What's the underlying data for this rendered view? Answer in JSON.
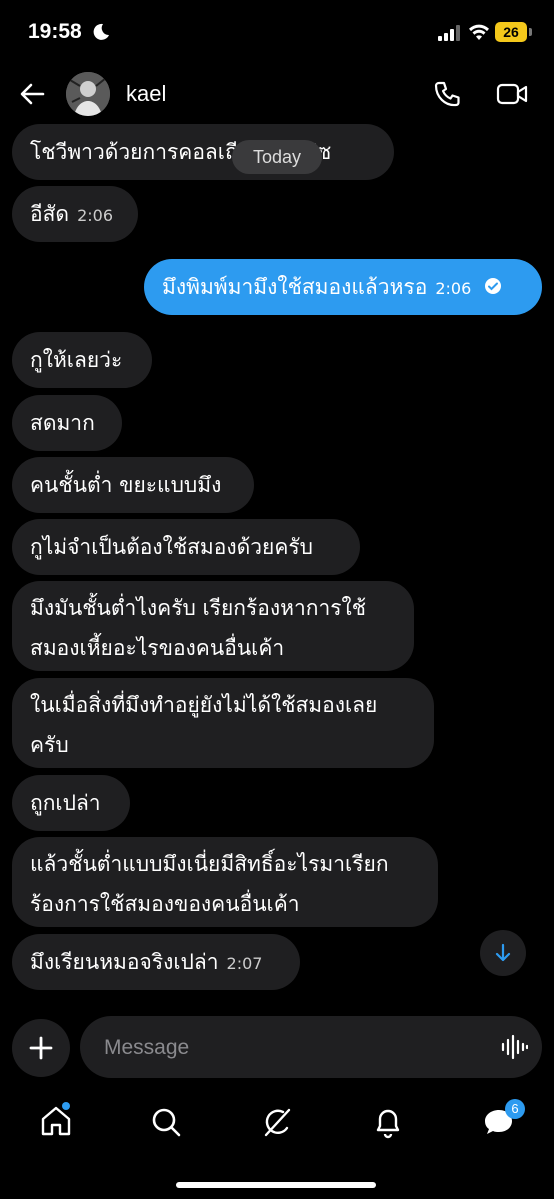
{
  "status_bar": {
    "time": "19:58",
    "battery": "26"
  },
  "header": {
    "contact_name": "kael"
  },
  "date_divider": "Today",
  "messages": [
    {
      "text": "โชวีพาวด้วยการคอลเถียงโยกเปซ",
      "time": "",
      "direction": "in"
    },
    {
      "text": "อีสัด",
      "time": "2:06",
      "direction": "in"
    },
    {
      "text": "มึงพิมพ์มามึงใช้สมองแล้วหรอ",
      "time": "2:06",
      "direction": "out"
    },
    {
      "text": "กูให้เลยว่ะ",
      "time": "",
      "direction": "in"
    },
    {
      "text": "สดมาก",
      "time": "",
      "direction": "in"
    },
    {
      "text": "คนชั้นต่ำ ขยะแบบมึง",
      "time": "",
      "direction": "in"
    },
    {
      "text": "กูไม่จำเป็นต้องใช้สมองด้วยครับ",
      "time": "",
      "direction": "in"
    },
    {
      "text": "มึงมันชั้นต่ำไงครับ เรียกร้องหาการใช้",
      "line2": "สมองเหี้ยอะไรของคนอื่นเค้า",
      "time": "",
      "direction": "in"
    },
    {
      "text": "ในเมื่อสิ่งที่มึงทำอยู่ยังไม่ได้ใช้สมองเลย",
      "line2": "ครับ",
      "time": "",
      "direction": "in"
    },
    {
      "text": "ถูกเปล่า",
      "time": "",
      "direction": "in"
    },
    {
      "text": "แล้วชั้นต่ำแบบมึงเนี่ยมีสิทธิ์อะไรมาเรียก",
      "line2": "ร้องการใช้สมองของคนอื่นเค้า",
      "time": "",
      "direction": "in"
    },
    {
      "text": "มึงเรียนหมอจริงเปล่า",
      "time": "2:07",
      "direction": "in"
    }
  ],
  "composer": {
    "placeholder": "Message"
  },
  "tabbar": {
    "messages_badge": "6"
  },
  "colors": {
    "accent": "#2d9bf0",
    "incoming_bubble": "#1f1f21",
    "background": "#000000"
  }
}
